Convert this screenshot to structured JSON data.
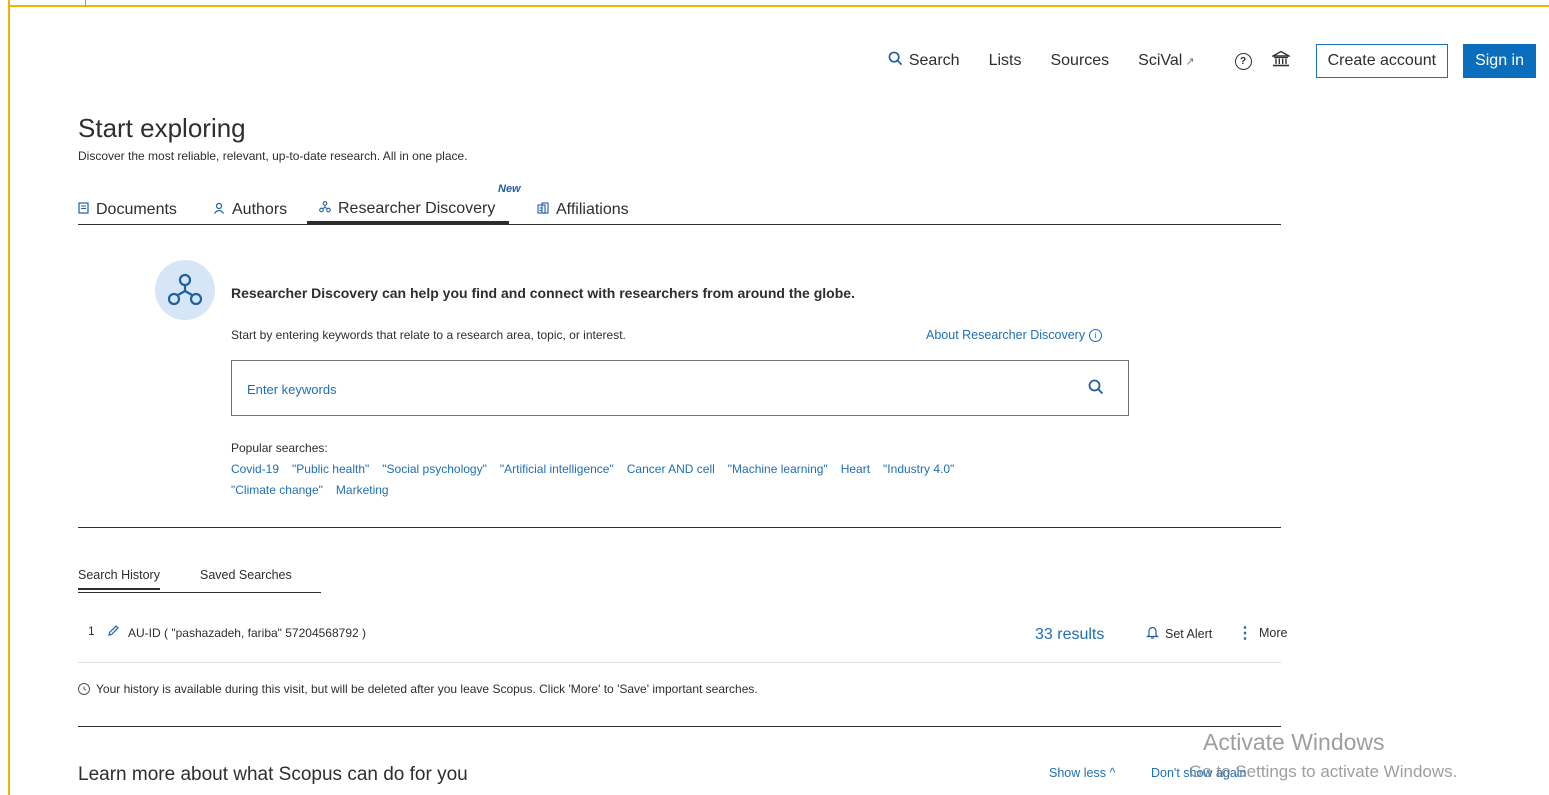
{
  "nav": {
    "search": "Search",
    "lists": "Lists",
    "sources": "Sources",
    "scival": "SciVal",
    "scival_ext": "↗",
    "help_icon": "help-icon",
    "institution_icon": "institution-icon",
    "create_account": "Create account",
    "sign_in": "Sign in"
  },
  "page": {
    "title": "Start exploring",
    "subtitle": "Discover the most reliable, relevant, up-to-date research. All in one place."
  },
  "tabs": {
    "documents": "Documents",
    "authors": "Authors",
    "researcher_discovery": "Researcher Discovery",
    "affiliations": "Affiliations",
    "new_badge": "New",
    "active": "Researcher Discovery"
  },
  "discovery": {
    "headline": "Researcher Discovery can help you find and connect with researchers from around the globe.",
    "instructions": "Start by entering keywords that relate to a research area, topic, or interest.",
    "about_link": "About Researcher Discovery",
    "search_placeholder": "Enter keywords",
    "popular_label": "Popular searches:",
    "popular_row1": [
      "Covid-19",
      "\"Public health\"",
      "\"Social psychology\"",
      "\"Artificial intelligence\"",
      "Cancer AND cell",
      "\"Machine learning\"",
      "Heart",
      "\"Industry 4.0\""
    ],
    "popular_row2": [
      "\"Climate change\"",
      "Marketing"
    ]
  },
  "history": {
    "tab_history": "Search History",
    "tab_saved": "Saved Searches",
    "rows": [
      {
        "number": "1",
        "query": "AU-ID ( \"pashazadeh, fariba\" 57204568792 )",
        "results": "33 results",
        "set_alert": "Set Alert",
        "more": "More"
      }
    ],
    "note": "Your history is available during this visit, but will be deleted after you leave Scopus. Click 'More' to 'Save' important searches."
  },
  "learn": {
    "title": "Learn more about what Scopus can do for you",
    "show_less": "Show less ^",
    "dont_show": "Don't show again"
  },
  "watermark": {
    "line1": "Activate Windows",
    "line2": "Go to Settings to activate Windows."
  },
  "colors": {
    "accent": "#1f6fb5",
    "primary_button": "#0a6ebd",
    "frame": "#f0b400",
    "icon_bg": "#d6e6f7"
  }
}
